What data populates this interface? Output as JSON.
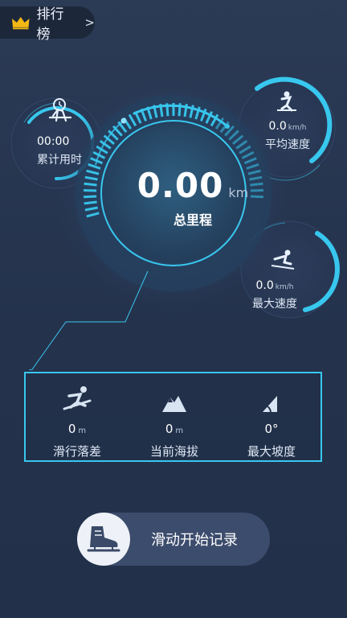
{
  "header": {
    "ranking_label": "排行榜",
    "chevron_glyph": ">"
  },
  "main_gauge": {
    "value": "0.00",
    "unit": "km",
    "label": "总里程"
  },
  "stats_small": {
    "time": {
      "value": "00:00",
      "label": "累计用时"
    },
    "avg_speed": {
      "value": "0.0",
      "unit": "km/h",
      "label": "平均速度"
    },
    "max_speed": {
      "value": "0.0",
      "unit": "km/h",
      "label": "最大速度"
    }
  },
  "stats_panel": [
    {
      "icon": "snowboard-icon",
      "value": "0",
      "unit": "m",
      "label": "滑行落差"
    },
    {
      "icon": "mountain-icon",
      "value": "0",
      "unit": "m",
      "label": "当前海拔"
    },
    {
      "icon": "slope-icon",
      "value": "0°",
      "unit": "",
      "label": "最大坡度"
    }
  ],
  "start_button": {
    "label": "滑动开始记录",
    "icon": "skate-boot-icon"
  },
  "colors": {
    "accent": "#38c7ee",
    "background": "#27354f",
    "panel_border": "#38c7ee"
  }
}
